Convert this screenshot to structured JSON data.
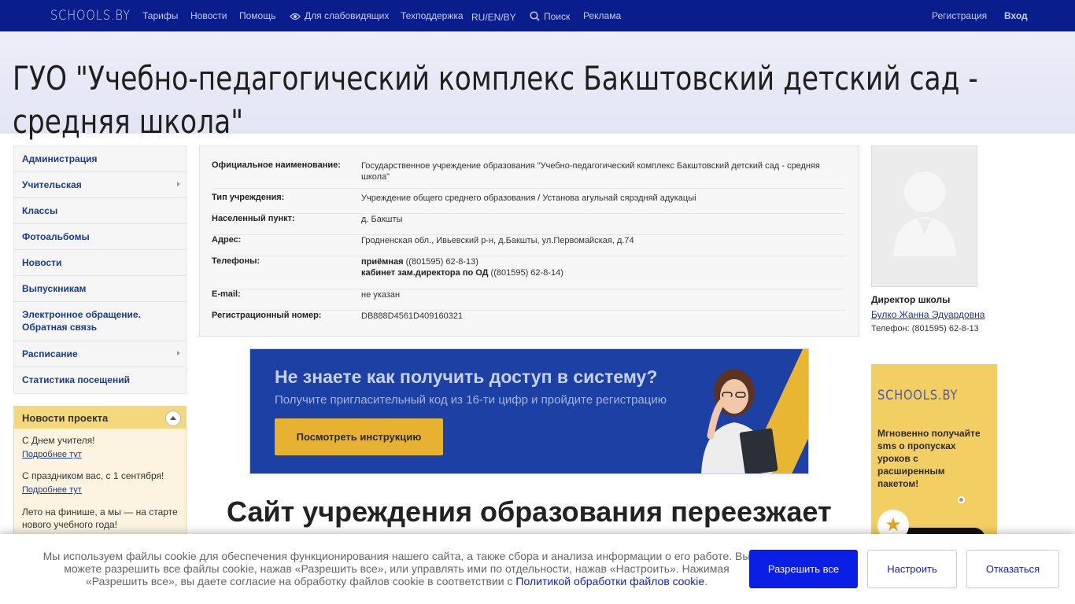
{
  "nav": {
    "logo": "SCHOOLS.BY",
    "links": [
      "Тарифы",
      "Новости",
      "Помощь",
      "Для слабовидящих",
      "Техподдержка",
      "RU/EN/BY",
      "Поиск",
      "Реклама"
    ],
    "register": "Регистрация",
    "login": "Вход"
  },
  "page_title": "ГУО \"Учебно-педагогический комплекс Бакштовский детский сад - средняя школа\"",
  "sidebar": {
    "items": [
      {
        "label": "Администрация",
        "has_sub": false
      },
      {
        "label": "Учительская",
        "has_sub": true
      },
      {
        "label": "Классы",
        "has_sub": false
      },
      {
        "label": "Фотоальбомы",
        "has_sub": false
      },
      {
        "label": "Новости",
        "has_sub": false
      },
      {
        "label": "Выпускникам",
        "has_sub": false
      },
      {
        "label": "Электронное обращение. Обратная связь",
        "has_sub": false
      },
      {
        "label": "Расписание",
        "has_sub": true
      },
      {
        "label": "Статистика посещений",
        "has_sub": false
      }
    ]
  },
  "project_news": {
    "title": "Новости проекта",
    "items": [
      {
        "text": "С Днем учителя!",
        "link": "Подробнее тут"
      },
      {
        "text": "С праздником вас, с 1 сентября!",
        "link": "Подробнее тут"
      },
      {
        "text": "Лето на финише, а мы — на старте нового учебного года!",
        "link": ""
      }
    ]
  },
  "info": {
    "official_name_label": "Официальное наименование:",
    "official_name": "Государственное учреждение образования \"Учебно-педагогический комплекс Бакштовский детский сад - средняя школа\"",
    "type_label": "Тип учреждения:",
    "type": "Учреждение общего среднего образования / Установа агульнай сярэдняй адукацыі",
    "locality_label": "Населенный пункт:",
    "locality": "д. Бакшты",
    "address_label": "Адрес:",
    "address": "Гродненская обл., Ивьевский р-н, д.Бакшты, ул.Первомайская, д.74",
    "phones_label": "Телефоны:",
    "phone1_name": "приёмная",
    "phone1": "((801595) 62-8-13)",
    "phone2_name": "кабинет зам.директора по ОД",
    "phone2": "((801595) 62-8-14)",
    "email_label": "E-mail:",
    "email": "не указан",
    "regnum_label": "Регистрационный номер:",
    "regnum": "DB888D4561D409160321"
  },
  "banner": {
    "title": "Не знаете как получить доступ в систему?",
    "subtitle": "Получите пригласительный код из 16-ти цифр и пройдите регистрацию",
    "button": "Посмотреть инструкцию"
  },
  "moving_heading": "Сайт учреждения образования переезжает",
  "director": {
    "title": "Директор школы",
    "name": "Булко Жанна Эдуардовна",
    "phone": "Телефон: (801595) 62-8-13"
  },
  "ad": {
    "logo": "SCHOOLS.BY",
    "text": "Мгновенно получайте sms о пропусках уроков с расширенным пакетом!"
  },
  "cookie": {
    "text": "Мы используем файлы cookie для обеспечения функционирования нашего сайта, а также сбора и анализа информации о его работе. Вы можете разрешить все файлы cookie, нажав «Разрешить все», или управлять ими по отдельности, нажав «Настроить». Нажимая «Разрешить все», вы даете согласие на обработку файлов cookie в соответствии с",
    "link": "Политикой обработки файлов cookie",
    "allow": "Разрешить все",
    "setup": "Настроить",
    "deny": "Отказаться"
  },
  "colors": {
    "nav_bg": "#0a1d8c",
    "link": "#1a3a8f",
    "accent_yellow": "#e7b232",
    "cookie_btn": "#0b1ee6"
  }
}
